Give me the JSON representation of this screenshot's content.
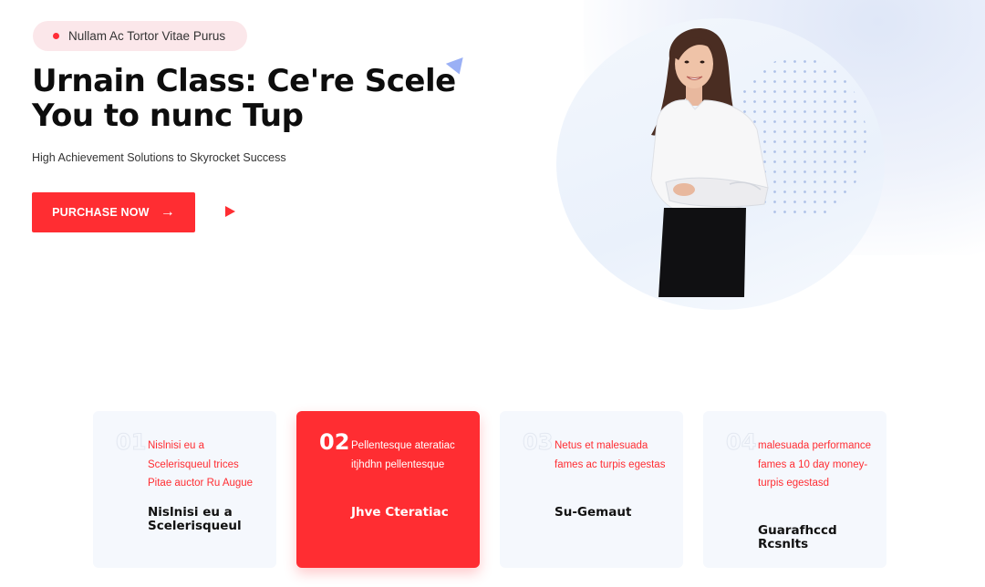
{
  "hero": {
    "badge": "Nullam Ac Tortor Vitae Purus",
    "title_line1": "Urnain Class: Ce're Scele",
    "title_line2": "You to nunc Tup",
    "subtitle": "High Achievement Solutions to Skyrocket Success",
    "cta_label": "PURCHASE NOW",
    "cta_icon": "arrow-right-icon",
    "play_icon": "play-icon"
  },
  "colors": {
    "accent": "#ff2d32",
    "badge_bg": "#fbe7ea",
    "card_bg": "#f5f8fd",
    "hero_circle": "#eaf1fb"
  },
  "features": [
    {
      "number": "01",
      "description": "Nislnisi eu a Scelerisqueul trices Pitae auctor Ru Augue",
      "title": "Nislnisi eu a Scelerisqueul",
      "active": false
    },
    {
      "number": "02",
      "description": "Pellentesque ateratiac itjhdhn pellentesque",
      "title": "Jhve Cteratiac",
      "active": true
    },
    {
      "number": "03",
      "description": "Netus et malesuada fames ac turpis egestas",
      "title": "Su-Gemaut",
      "active": false
    },
    {
      "number": "04",
      "description": "malesuada performance fames a 10 day money-turpis egestasd",
      "title": "Guarafhccd Rcsnlts",
      "active": false
    }
  ]
}
